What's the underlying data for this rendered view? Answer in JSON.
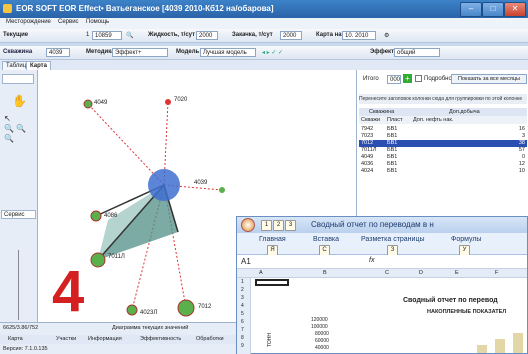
{
  "app": {
    "title": "EOR SOFT   EOR Effect• Ватьеганское  [4039 2010-Кб12 на/обарова]",
    "menu": [
      "Месторождение",
      "Сервис",
      "Помощь"
    ]
  },
  "toolbar1": {
    "mode": "Текущие",
    "field_no": "1",
    "field_val": "10859",
    "liquid_label": "Жидкость, т/сут",
    "liquid_val": "2000",
    "injection_label": "Закачка, т/сут",
    "injection_val": "2000",
    "map_label": "Карта на",
    "map_val": "10. 2010"
  },
  "toolbar2": {
    "well_label": "Скважина",
    "well_val": "4039",
    "method_label": "Методика",
    "method_val": "Эффект+",
    "model_label": "Модель",
    "model_val": "Лучшая модель",
    "effect_label": "Эффект",
    "effect_val": "общий"
  },
  "tabs": [
    "Таблица",
    "Карта"
  ],
  "left": {
    "service_label": "Сервис"
  },
  "map": {
    "nodes": [
      "4049",
      "7020",
      "4086",
      "7011Л",
      "4039",
      "4023Л",
      "7012"
    ]
  },
  "grid": {
    "total_label": "Итого",
    "total_val": "000",
    "detail_label": "Подробно",
    "show_all_label": "Показать за все месяцы",
    "hint": "Перенесите заголовок колонки сюда для группировки по этой колонке",
    "col_well": "Скважина",
    "col_prod": "Доп.добыча",
    "subcols": [
      "Скважи",
      "Пласт",
      "Доп. нефть нак."
    ],
    "rows": [
      {
        "well": "7942",
        "layer": "БВ1",
        "val": "16"
      },
      {
        "well": "7023",
        "layer": "БВ1",
        "val": "3"
      },
      {
        "well": "7012",
        "layer": "БВ1",
        "val": "38"
      },
      {
        "well": "7011Л",
        "layer": "БВ1",
        "val": "57"
      },
      {
        "well": "4049",
        "layer": "БВ1",
        "val": "0"
      },
      {
        "well": "4036",
        "layer": "БВ1",
        "val": "12"
      },
      {
        "well": "4024",
        "layer": "БВ1",
        "val": "10"
      }
    ]
  },
  "status": {
    "coords": "6625/3.86/752",
    "diagram": "Диаграмма текущих значений",
    "tabs": [
      "Карта",
      "Участки",
      "Информация",
      "Эффективность",
      "Обработки"
    ],
    "version": "Версия: 7.1.0.135"
  },
  "overlay_number": "4",
  "excel": {
    "title": "Сводный отчет по переводам в н",
    "ribbon": [
      "Главная",
      "Вставка",
      "Разметка страницы",
      "Формулы"
    ],
    "keytips": [
      "1",
      "2",
      "3",
      "Я",
      "С",
      "З",
      "У"
    ],
    "namebox": "A1",
    "fx": "fx",
    "cols": [
      "A",
      "B",
      "C",
      "D",
      "E",
      "F"
    ],
    "rows": [
      "1",
      "2",
      "3",
      "4",
      "5",
      "6",
      "7",
      "8",
      "9",
      "10"
    ],
    "report_title": "Сводный отчет по перевод",
    "sub_title": "НАКОПЛЕННЫЕ ПОКАЗАТЕЛ",
    "axis_label": "ТОНН",
    "yticks": [
      "120000",
      "100000",
      "80000",
      "60000",
      "40000",
      "20000"
    ]
  }
}
